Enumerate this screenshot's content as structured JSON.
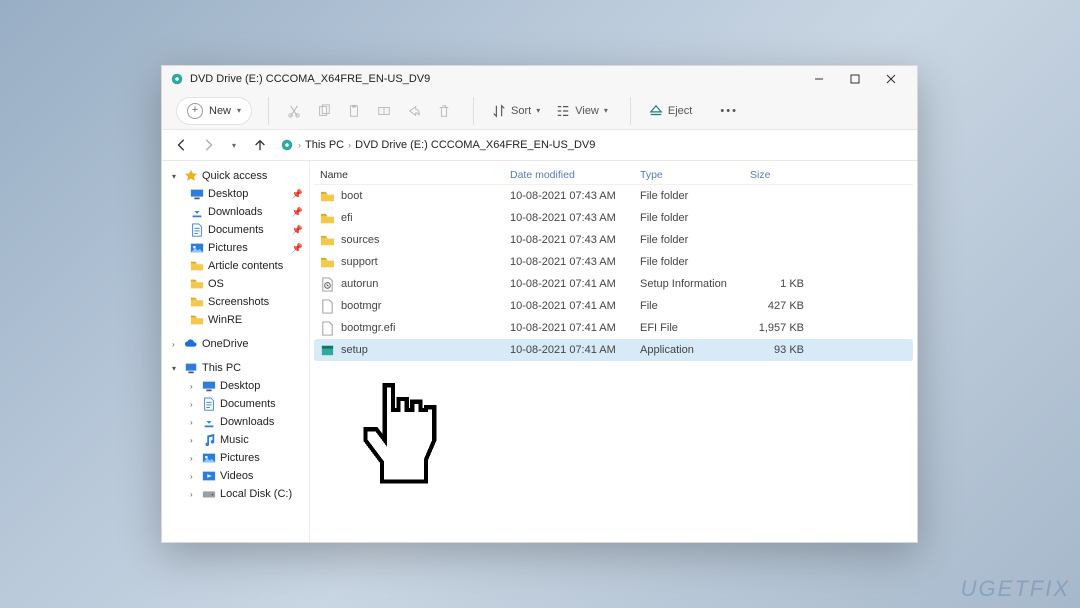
{
  "window": {
    "title": "DVD Drive (E:) CCCOMA_X64FRE_EN-US_DV9"
  },
  "toolbar": {
    "new_label": "New",
    "sort_label": "Sort",
    "view_label": "View",
    "eject_label": "Eject"
  },
  "breadcrumb": {
    "root": "This PC",
    "current": "DVD Drive (E:) CCCOMA_X64FRE_EN-US_DV9"
  },
  "sidebar": {
    "quick_access": "Quick access",
    "items_qa": [
      {
        "label": "Desktop",
        "icon": "desktop",
        "pinned": true
      },
      {
        "label": "Downloads",
        "icon": "downloads",
        "pinned": true
      },
      {
        "label": "Documents",
        "icon": "documents",
        "pinned": true
      },
      {
        "label": "Pictures",
        "icon": "pictures",
        "pinned": true
      },
      {
        "label": "Article contents",
        "icon": "folder",
        "pinned": false
      },
      {
        "label": "OS",
        "icon": "folder",
        "pinned": false
      },
      {
        "label": "Screenshots",
        "icon": "folder",
        "pinned": false
      },
      {
        "label": "WinRE",
        "icon": "folder",
        "pinned": false
      }
    ],
    "onedrive": "OneDrive",
    "this_pc": "This PC",
    "items_pc": [
      {
        "label": "Desktop",
        "icon": "desktop"
      },
      {
        "label": "Documents",
        "icon": "documents"
      },
      {
        "label": "Downloads",
        "icon": "downloads"
      },
      {
        "label": "Music",
        "icon": "music"
      },
      {
        "label": "Pictures",
        "icon": "pictures"
      },
      {
        "label": "Videos",
        "icon": "videos"
      },
      {
        "label": "Local Disk (C:)",
        "icon": "disk"
      }
    ]
  },
  "columns": {
    "name": "Name",
    "modified": "Date modified",
    "type": "Type",
    "size": "Size"
  },
  "files": [
    {
      "name": "boot",
      "icon": "folder",
      "modified": "10-08-2021 07:43 AM",
      "type": "File folder",
      "size": "",
      "selected": false
    },
    {
      "name": "efi",
      "icon": "folder",
      "modified": "10-08-2021 07:43 AM",
      "type": "File folder",
      "size": "",
      "selected": false
    },
    {
      "name": "sources",
      "icon": "folder",
      "modified": "10-08-2021 07:43 AM",
      "type": "File folder",
      "size": "",
      "selected": false
    },
    {
      "name": "support",
      "icon": "folder",
      "modified": "10-08-2021 07:43 AM",
      "type": "File folder",
      "size": "",
      "selected": false
    },
    {
      "name": "autorun",
      "icon": "inf",
      "modified": "10-08-2021 07:41 AM",
      "type": "Setup Information",
      "size": "1 KB",
      "selected": false
    },
    {
      "name": "bootmgr",
      "icon": "file",
      "modified": "10-08-2021 07:41 AM",
      "type": "File",
      "size": "427 KB",
      "selected": false
    },
    {
      "name": "bootmgr.efi",
      "icon": "file",
      "modified": "10-08-2021 07:41 AM",
      "type": "EFI File",
      "size": "1,957 KB",
      "selected": false
    },
    {
      "name": "setup",
      "icon": "app",
      "modified": "10-08-2021 07:41 AM",
      "type": "Application",
      "size": "93 KB",
      "selected": true
    }
  ],
  "watermark": "UGETFIX"
}
